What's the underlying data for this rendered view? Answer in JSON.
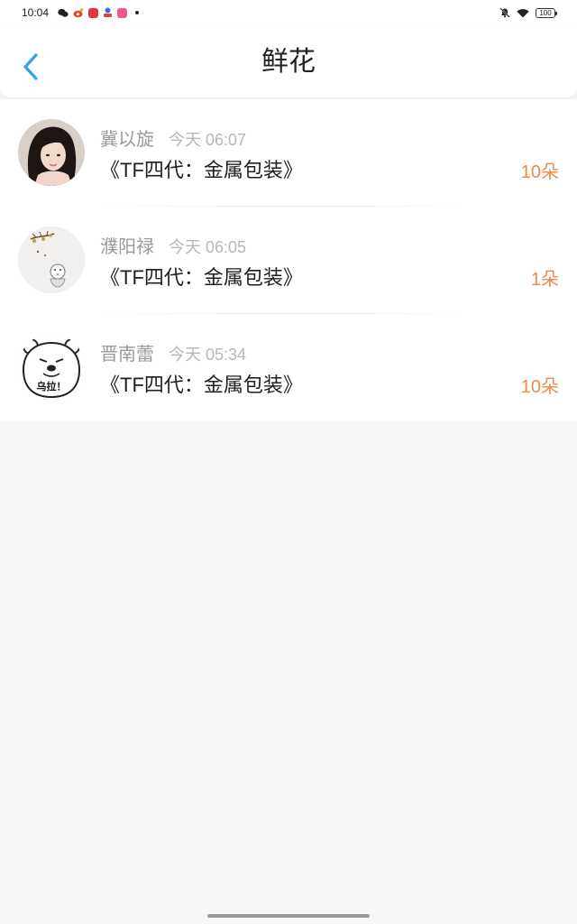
{
  "status_bar": {
    "time": "10:04",
    "battery": "100",
    "app_icons": [
      {
        "name": "wechat-icon",
        "color": "#222222"
      },
      {
        "name": "weibo-icon",
        "color": "#e6422a"
      },
      {
        "name": "app-red-icon",
        "color": "#e8323c"
      },
      {
        "name": "app-blue-icon",
        "color": "#3a6fd8"
      },
      {
        "name": "app-pink-icon",
        "color": "#f0588a"
      }
    ]
  },
  "header": {
    "title": "鲜花",
    "back_icon": "chevron-left-icon",
    "accent_color": "#2ba3f1"
  },
  "items": [
    {
      "name": "冀以旋",
      "time": "今天 06:07",
      "gift": "《TF四代：金属包装》",
      "count": "10朵",
      "avatar": "photo-avatar"
    },
    {
      "name": "濮阳禄",
      "time": "今天 06:05",
      "gift": "《TF四代：金属包装》",
      "count": "1朵",
      "avatar": "cartoon-avatar"
    },
    {
      "name": "晋南蕾",
      "time": "今天 05:34",
      "gift": "《TF四代：金属包装》",
      "count": "10朵",
      "avatar": "bear-meme-avatar"
    }
  ],
  "avatar_meme_text": "乌拉！",
  "colors": {
    "count": "#ec8a4c",
    "name": "#9a9a9a",
    "background": "#f8f6f7"
  }
}
